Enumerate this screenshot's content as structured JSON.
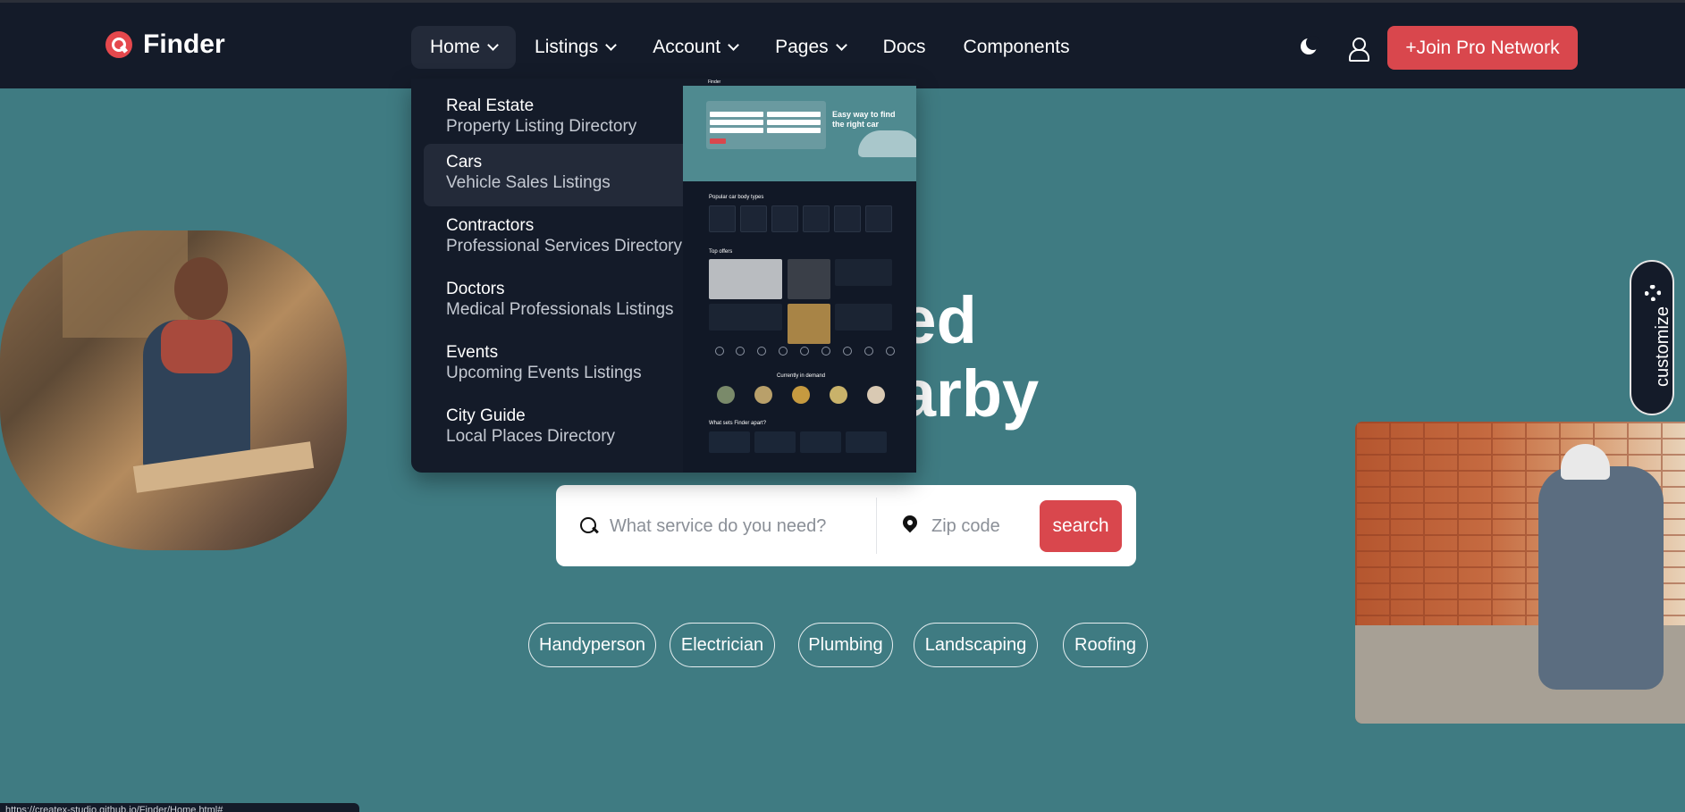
{
  "brand": {
    "name": "Finder"
  },
  "nav": {
    "items": [
      {
        "label": "Home",
        "dropdown": true
      },
      {
        "label": "Listings",
        "dropdown": true
      },
      {
        "label": "Account",
        "dropdown": true
      },
      {
        "label": "Pages",
        "dropdown": true
      },
      {
        "label": "Docs",
        "dropdown": false
      },
      {
        "label": "Components",
        "dropdown": false
      }
    ],
    "join_label": "+Join Pro Network"
  },
  "home_menu": {
    "items": [
      {
        "title": "Real Estate",
        "subtitle": "Property Listing Directory"
      },
      {
        "title": "Cars",
        "subtitle": "Vehicle Sales Listings"
      },
      {
        "title": "Contractors",
        "subtitle": "Professional Services Directory"
      },
      {
        "title": "Doctors",
        "subtitle": "Medical Professionals Listings"
      },
      {
        "title": "Events",
        "subtitle": "Upcoming Events Listings"
      },
      {
        "title": "City Guide",
        "subtitle": "Local Places Directory"
      }
    ],
    "preview": {
      "logo_text": "Finder",
      "headline": "Easy way to find the right car",
      "section_body_types": "Popular car body types",
      "section_top_offers": "Top offers",
      "section_demand": "Currently in demand",
      "section_why": "What sets Finder apart?"
    }
  },
  "hero": {
    "title_line1": "-rated",
    "title_line2": "s nearby"
  },
  "search": {
    "service_placeholder": "What service do you need?",
    "zip_placeholder": "Zip code",
    "button_label": "search"
  },
  "chips": [
    "Handyperson",
    "Electrician",
    "Plumbing",
    "Landscaping",
    "Roofing"
  ],
  "customize_label": "customize",
  "status_url": "https://createx-studio.github.io/Finder/Home.html#"
}
